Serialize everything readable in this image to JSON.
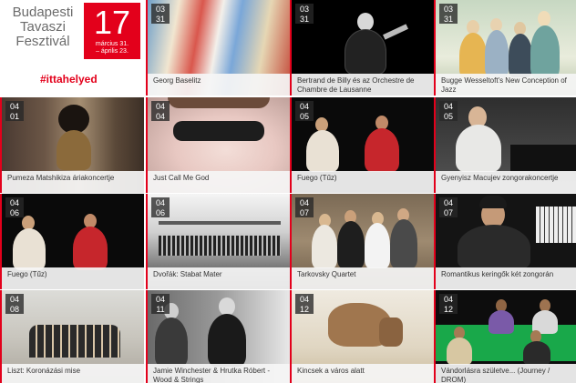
{
  "brand": {
    "title_line1": "Budapesti",
    "title_line2": "Tavaszi",
    "title_line3": "Fesztivál",
    "day": "17",
    "dates_line1": "március 31.",
    "dates_line2": "– április 23.",
    "hashtag": "#ittahelyed",
    "accent_color": "#e3001b"
  },
  "tiles": [
    {
      "date_month": "03",
      "date_day": "31",
      "title": "Georg Baselitz"
    },
    {
      "date_month": "03",
      "date_day": "31",
      "title": "Bertrand de Billy és az Orchestre de Chambre de Lausanne"
    },
    {
      "date_month": "03",
      "date_day": "31",
      "title": "Bugge Wesseltoft's New Conception of Jazz"
    },
    {
      "date_month": "04",
      "date_day": "01",
      "title": "Pumeza Matshikiza áriakoncertje"
    },
    {
      "date_month": "04",
      "date_day": "04",
      "title": "Just Call Me God"
    },
    {
      "date_month": "04",
      "date_day": "05",
      "title": "Fuego (Tűz)"
    },
    {
      "date_month": "04",
      "date_day": "05",
      "title": "Gyenyisz Macujev zongorakoncertje"
    },
    {
      "date_month": "04",
      "date_day": "06",
      "title": "Fuego (Tűz)"
    },
    {
      "date_month": "04",
      "date_day": "06",
      "title": "Dvořák: Stabat Mater"
    },
    {
      "date_month": "04",
      "date_day": "07",
      "title": "Tarkovsky Quartet"
    },
    {
      "date_month": "04",
      "date_day": "07",
      "title": "Romantikus keringők két zongorán"
    },
    {
      "date_month": "04",
      "date_day": "08",
      "title": "Liszt: Koronázási mise"
    },
    {
      "date_month": "04",
      "date_day": "11",
      "title": "Jamie Winchester & Hrutka Róbert - Wood & Strings"
    },
    {
      "date_month": "04",
      "date_day": "12",
      "title": "Kincsek a város alatt"
    },
    {
      "date_month": "04",
      "date_day": "12",
      "title": "Vándorlásra születve... (Journey / DROM)"
    }
  ]
}
